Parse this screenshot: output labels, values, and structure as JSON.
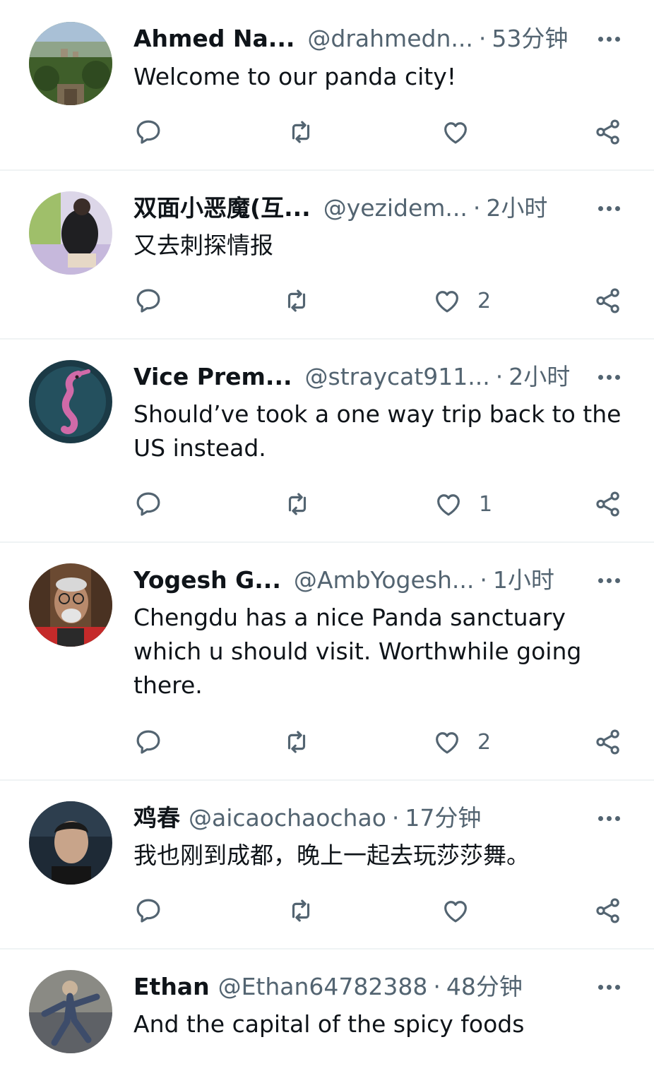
{
  "replies": [
    {
      "name": "Ahmed Na...",
      "handle": "@drahmedn...",
      "separator": "·",
      "time": "53分钟",
      "text": "Welcome to our panda city!",
      "likes": "",
      "avatar_icon": "cityscape-avatar"
    },
    {
      "name": "双面小恶魔(互...",
      "handle": "@yezidem...",
      "separator": "·",
      "time": "2小时",
      "text": "又去刺探情报",
      "likes": "2",
      "avatar_icon": "person-avatar"
    },
    {
      "name": "Vice Prem...",
      "handle": "@straycat911...",
      "separator": "·",
      "time": "2小时",
      "text": "Should’ve took a one way trip back to the US instead.",
      "likes": "1",
      "avatar_icon": "seahorse-avatar"
    },
    {
      "name": "Yogesh G...",
      "handle": "@AmbYogesh...",
      "separator": "·",
      "time": "1小时",
      "text": "Chengdu has a nice Panda sanctuary which u should visit. Worthwhile going there.",
      "likes": "2",
      "avatar_icon": "man-with-glasses-avatar"
    },
    {
      "name": "鸡春",
      "handle": "@aicaochaochao",
      "separator": "·",
      "time": "17分钟",
      "text": "我也刚到成都，晚上一起去玩莎莎舞。",
      "likes": "",
      "avatar_icon": "man-portrait-avatar"
    },
    {
      "name": "Ethan",
      "handle": "@Ethan64782388",
      "separator": "·",
      "time": "48分钟",
      "text": "And the capital of the spicy foods",
      "likes": "",
      "avatar_icon": "figure-avatar"
    }
  ],
  "colors": {
    "text": "#0f1419",
    "secondary": "#536471",
    "separator": "#eff3f4"
  }
}
